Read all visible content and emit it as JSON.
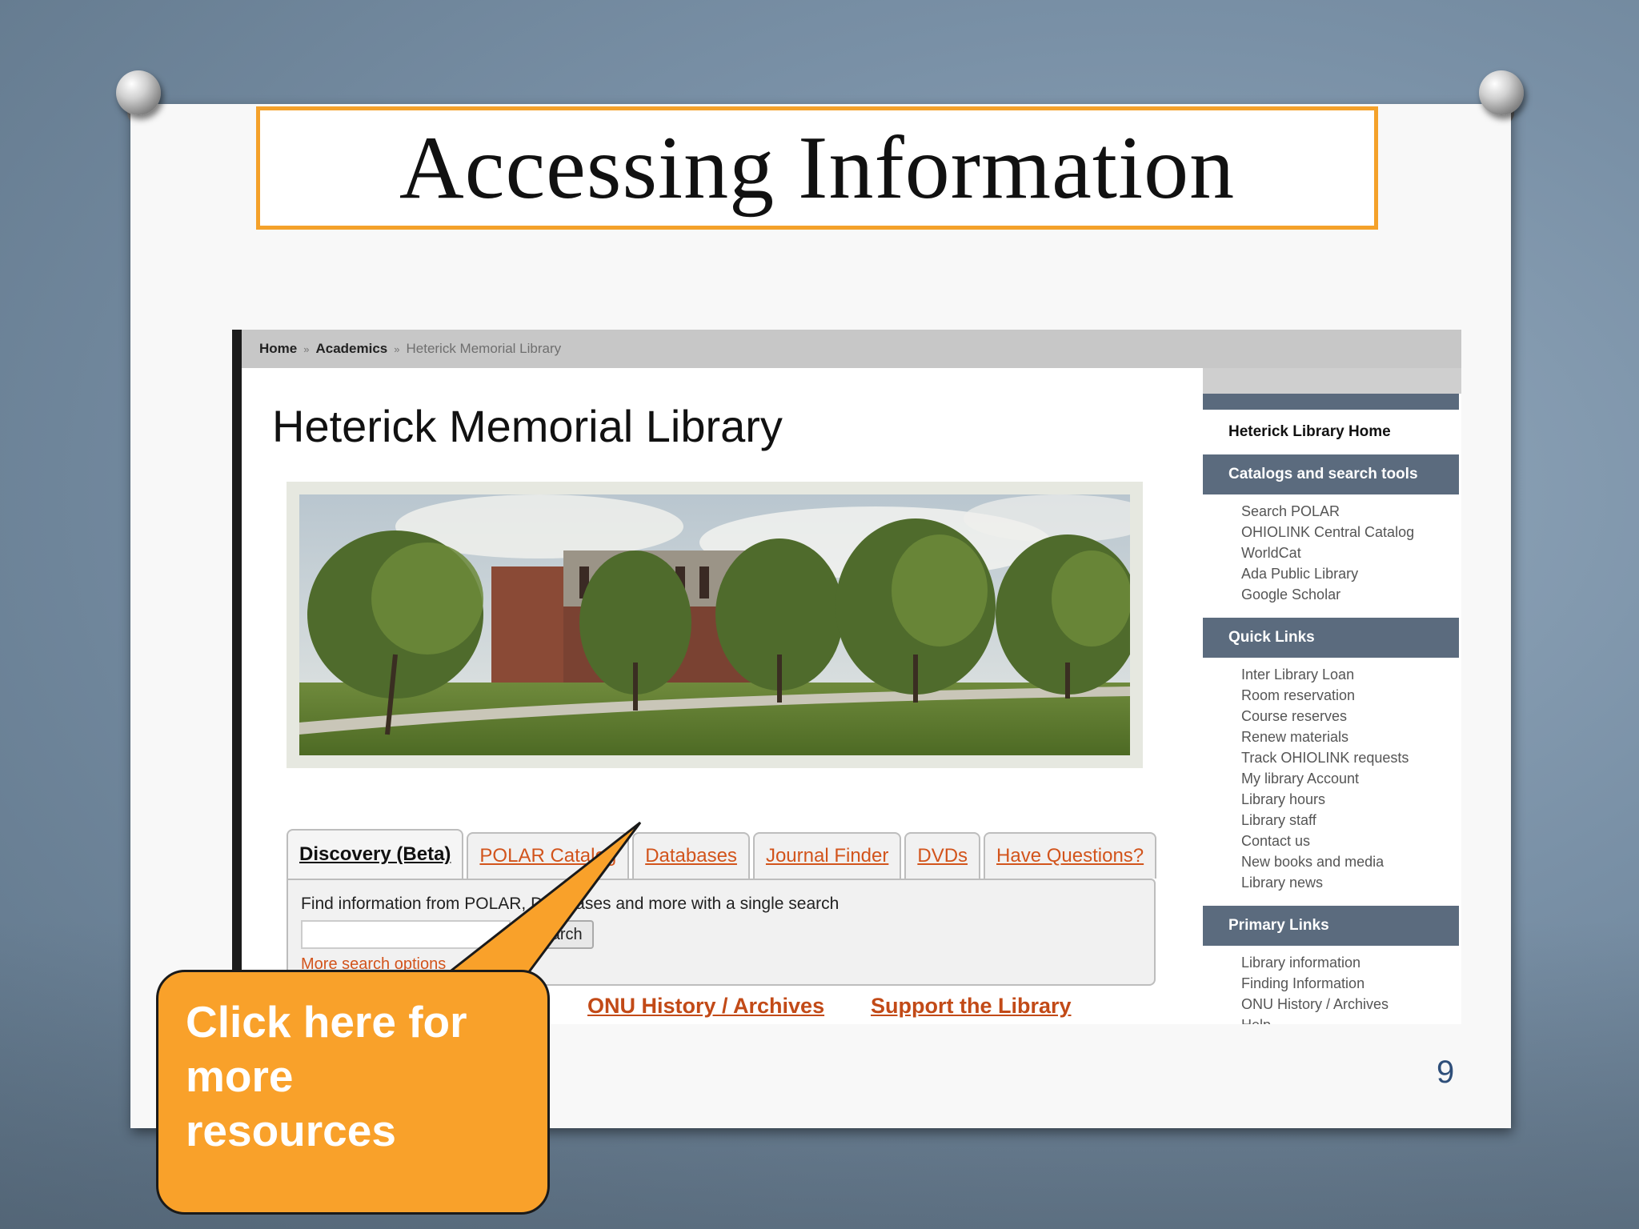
{
  "slide": {
    "title": "Accessing Information",
    "page_number": "9",
    "accent": "#f4a12a"
  },
  "screenshot": {
    "breadcrumb": [
      "Home",
      "Academics",
      "Heterick Memorial Library"
    ],
    "breadcrumb_sep": "»",
    "page_title": "Heterick Memorial Library",
    "tabs": [
      "Discovery (Beta)",
      "POLAR Catalog",
      "Databases",
      "Journal Finder",
      "DVDs",
      "Have Questions?"
    ],
    "search_hint": "Find information from POLAR, Databases and more with a single search",
    "search_button": "Search",
    "more_options": "More search options",
    "bottom_links": [
      "ONU History / Archives",
      "Support the Library"
    ],
    "link_color": "#d2541c",
    "sidebar": {
      "home": "Heterick Library Home",
      "sections": [
        {
          "header": "Catalogs and search tools",
          "items": [
            "Search POLAR",
            "OHIOLINK Central Catalog",
            "WorldCat",
            "Ada Public Library",
            "Google Scholar"
          ]
        },
        {
          "header": "Quick Links",
          "items": [
            "Inter Library Loan",
            "Room reservation",
            "Course reserves",
            "Renew materials",
            "Track OHIOLINK requests",
            "My library Account",
            "Library hours",
            "Library staff",
            "Contact us",
            "New books and media",
            "Library news"
          ]
        },
        {
          "header": "Primary Links",
          "items": [
            "Library information",
            "Finding Information",
            "ONU History / Archives",
            "Help"
          ]
        }
      ]
    }
  },
  "callout": {
    "lines": [
      "Click here for",
      "more",
      "resources"
    ],
    "color": "#f9a12a"
  }
}
